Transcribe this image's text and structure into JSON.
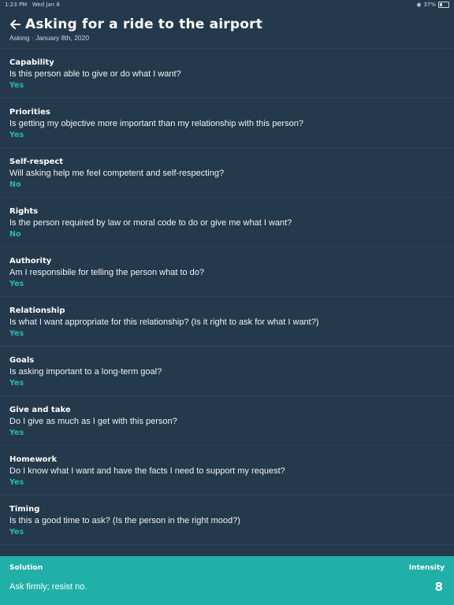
{
  "status_bar": {
    "time": "1:23 PM",
    "date": "Wed Jan 8",
    "battery": "37%"
  },
  "header": {
    "title": "Asking for a ride to the airport",
    "subtitle": "Asking · January 8th, 2020"
  },
  "items": [
    {
      "label": "Capability",
      "question": "Is this person able to give or do what I want?",
      "answer": "Yes"
    },
    {
      "label": "Priorities",
      "question": "Is getting my objective more important than my relationship with this person?",
      "answer": "Yes"
    },
    {
      "label": "Self-respect",
      "question": "Will asking help me feel competent and self-respecting?",
      "answer": "No"
    },
    {
      "label": "Rights",
      "question": "Is the person required by law or moral code to do or give me what I want?",
      "answer": "No"
    },
    {
      "label": "Authority",
      "question": "Am I responsibile for telling the person what to do?",
      "answer": "Yes"
    },
    {
      "label": "Relationship",
      "question": "Is what I want appropriate for this relationship? (Is it right to ask for what I want?)",
      "answer": "Yes"
    },
    {
      "label": "Goals",
      "question": "Is asking important to a long-term goal?",
      "answer": "Yes"
    },
    {
      "label": "Give and take",
      "question": "Do I give as much as I get with this person?",
      "answer": "Yes"
    },
    {
      "label": "Homework",
      "question": "Do I know what I want and have the facts I need to support my request?",
      "answer": "Yes"
    },
    {
      "label": "Timing",
      "question": "Is this a good time to ask? (Is the person in the right mood?)",
      "answer": "Yes"
    }
  ],
  "solution": {
    "label": "Solution",
    "value": "Ask firmly; resist no.",
    "intensity_label": "Intensity",
    "intensity_value": "8"
  },
  "colors": {
    "background": "#24394b",
    "accent": "#20b0a8",
    "answer": "#2ab8b0"
  },
  "icons": {
    "back": "arrow-left-icon",
    "wifi": "wifi-icon",
    "battery": "battery-icon"
  }
}
